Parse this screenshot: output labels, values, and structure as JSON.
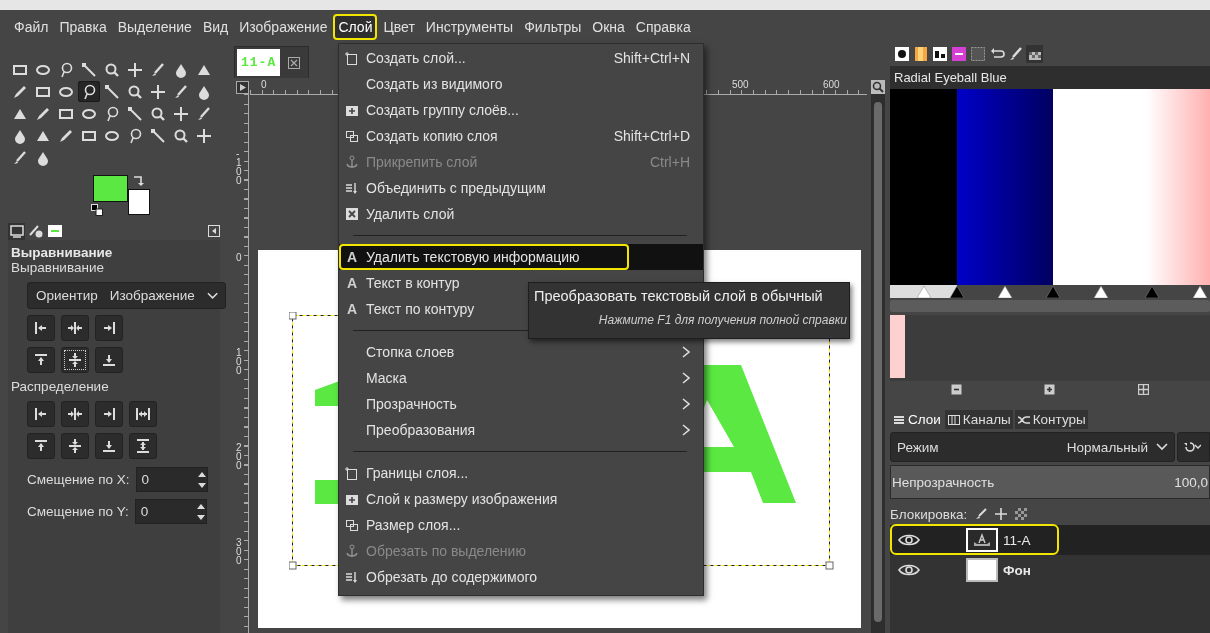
{
  "menubar": [
    {
      "label": "Файл",
      "selected": false
    },
    {
      "label": "Правка",
      "selected": false
    },
    {
      "label": "Выделение",
      "selected": false
    },
    {
      "label": "Вид",
      "selected": false
    },
    {
      "label": "Изображение",
      "selected": false
    },
    {
      "label": "Слой",
      "selected": true
    },
    {
      "label": "Цвет",
      "selected": false
    },
    {
      "label": "Инструменты",
      "selected": false
    },
    {
      "label": "Фильтры",
      "selected": false
    },
    {
      "label": "Окна",
      "selected": false
    },
    {
      "label": "Справка",
      "selected": false
    }
  ],
  "toolbox": {
    "tools": [
      {
        "selected": false
      },
      {
        "selected": false
      },
      {
        "selected": false
      },
      {
        "selected": false
      },
      {
        "selected": false
      },
      {
        "selected": false
      },
      {
        "selected": false
      },
      {
        "selected": false
      },
      {
        "selected": false
      },
      {
        "selected": false
      },
      {
        "selected": false
      },
      {
        "selected": false
      },
      {
        "selected": true
      },
      {
        "selected": false
      },
      {
        "selected": false
      },
      {
        "selected": false
      },
      {
        "selected": false
      },
      {
        "selected": false
      },
      {
        "selected": false
      },
      {
        "selected": false
      },
      {
        "selected": false
      },
      {
        "selected": false
      },
      {
        "selected": false
      },
      {
        "selected": false
      },
      {
        "selected": false
      },
      {
        "selected": false
      },
      {
        "selected": false
      },
      {
        "selected": false
      },
      {
        "selected": false
      },
      {
        "selected": false
      },
      {
        "selected": false
      },
      {
        "selected": false
      },
      {
        "selected": false
      },
      {
        "selected": false
      },
      {
        "selected": false
      },
      {
        "selected": false
      },
      {
        "selected": false
      },
      {
        "selected": false
      }
    ],
    "swatches": [
      {
        "color": "#5be843"
      },
      {
        "color": "#ffffff"
      }
    ],
    "dock_tabs": [
      {
        "selected": true
      },
      {
        "selected": false
      },
      {
        "selected": false
      }
    ]
  },
  "tool_options": {
    "title": "Выравнивание",
    "subtitle": "Выравнивание",
    "relative": {
      "label": "Ориентир",
      "value": "Изображение"
    },
    "align_buttons": [
      {
        "focused": false
      },
      {
        "focused": false
      },
      {
        "focused": false
      },
      {
        "focused": false
      },
      {
        "focused": true
      },
      {
        "focused": false
      }
    ],
    "distribute_title": "Распределение",
    "offsets": [
      {
        "label": "Смещение по X:",
        "value": "0"
      },
      {
        "label": "Смещение по Y:",
        "value": "0"
      }
    ]
  },
  "canvas": {
    "image_tab": "11-A",
    "top_ruler": [
      "0",
      "500",
      "600"
    ],
    "left_ruler": [
      "-100",
      "0",
      "100",
      "200",
      "300"
    ]
  },
  "layer_menu": [
    {
      "kind": "icon",
      "label": "Создать слой...",
      "shortcut": "Shift+Ctrl+N",
      "disabled": false,
      "highlighted": false
    },
    {
      "kind": "plain",
      "label": "Создать из видимого",
      "disabled": false,
      "highlighted": false
    },
    {
      "kind": "icon",
      "label": "Создать группу слоёв...",
      "disabled": false,
      "highlighted": false
    },
    {
      "kind": "icon",
      "label": "Создать копию слоя",
      "shortcut": "Shift+Ctrl+D",
      "disabled": false,
      "highlighted": false
    },
    {
      "kind": "icon",
      "label": "Прикрепить слой",
      "shortcut": "Ctrl+H",
      "disabled": true,
      "highlighted": false
    },
    {
      "kind": "icon",
      "label": "Объединить с предыдущим",
      "disabled": false,
      "highlighted": false
    },
    {
      "kind": "icon",
      "label": "Удалить слой",
      "disabled": false,
      "highlighted": false
    },
    {
      "kind": "separator"
    },
    {
      "kind": "glyph",
      "glyph": "A",
      "label": "Удалить текстовую информацию",
      "disabled": false,
      "highlighted": true
    },
    {
      "kind": "glyph",
      "glyph": "A",
      "label": "Текст в контур",
      "disabled": false,
      "highlighted": false
    },
    {
      "kind": "glyph",
      "glyph": "A",
      "label": "Текст по контуру",
      "disabled": false,
      "highlighted": false
    },
    {
      "kind": "separator"
    },
    {
      "kind": "submenu",
      "label": "Стопка слоев",
      "disabled": false,
      "highlighted": false
    },
    {
      "kind": "submenu",
      "label": "Маска",
      "disabled": false,
      "highlighted": false
    },
    {
      "kind": "submenu",
      "label": "Прозрачность",
      "disabled": false,
      "highlighted": false
    },
    {
      "kind": "submenu",
      "label": "Преобразования",
      "disabled": false,
      "highlighted": false
    },
    {
      "kind": "separator"
    },
    {
      "kind": "icon",
      "label": "Границы слоя...",
      "disabled": false,
      "highlighted": false
    },
    {
      "kind": "icon",
      "label": "Слой к размеру изображения",
      "disabled": false,
      "highlighted": false
    },
    {
      "kind": "icon",
      "label": "Размер слоя...",
      "disabled": false,
      "highlighted": false
    },
    {
      "kind": "icon",
      "label": "Обрезать по выделению",
      "disabled": true,
      "highlighted": false
    },
    {
      "kind": "icon",
      "label": "Обрезать до содержимого",
      "disabled": false,
      "highlighted": false
    }
  ],
  "tooltip": {
    "text": "Преобразовать текстовый слой в обычный",
    "hint": "Нажмите F1 для получения полной справки"
  },
  "dock": {
    "tabs": [
      {
        "selected": false
      },
      {
        "selected": false
      },
      {
        "selected": false
      },
      {
        "selected": false
      },
      {
        "selected": false
      },
      {
        "selected": false
      },
      {
        "selected": false
      },
      {
        "selected": true
      }
    ],
    "gradient": {
      "name": "Radial Eyeball Blue"
    },
    "layer_tabs": [
      {
        "label": "Слои",
        "selected": true
      },
      {
        "label": "Каналы",
        "selected": false
      },
      {
        "label": "Контуры",
        "selected": false
      }
    ],
    "mode": {
      "label": "Режим",
      "value": "Нормальный"
    },
    "opacity": {
      "label": "Непрозрачность",
      "value": "100,0",
      "level": 1
    },
    "lock_label": "Блокировка:",
    "layers": [
      {
        "name": "11-A",
        "kind": "text",
        "visible": true,
        "selected": true
      },
      {
        "name": "Фон",
        "kind": "image",
        "visible": true,
        "selected": false
      }
    ]
  }
}
